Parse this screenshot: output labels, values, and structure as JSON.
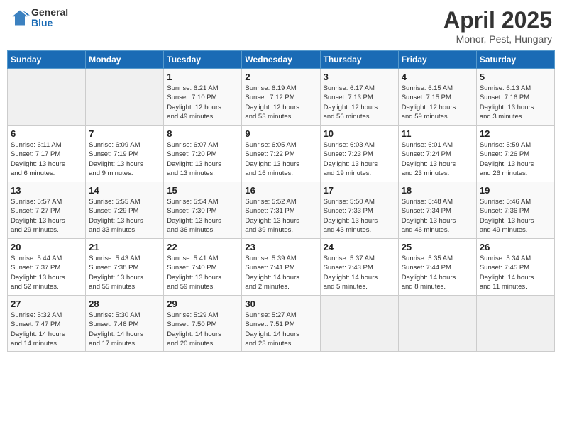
{
  "logo": {
    "general": "General",
    "blue": "Blue"
  },
  "title": "April 2025",
  "subtitle": "Monor, Pest, Hungary",
  "days_of_week": [
    "Sunday",
    "Monday",
    "Tuesday",
    "Wednesday",
    "Thursday",
    "Friday",
    "Saturday"
  ],
  "weeks": [
    [
      {
        "day": "",
        "info": ""
      },
      {
        "day": "",
        "info": ""
      },
      {
        "day": "1",
        "info": "Sunrise: 6:21 AM\nSunset: 7:10 PM\nDaylight: 12 hours\nand 49 minutes."
      },
      {
        "day": "2",
        "info": "Sunrise: 6:19 AM\nSunset: 7:12 PM\nDaylight: 12 hours\nand 53 minutes."
      },
      {
        "day": "3",
        "info": "Sunrise: 6:17 AM\nSunset: 7:13 PM\nDaylight: 12 hours\nand 56 minutes."
      },
      {
        "day": "4",
        "info": "Sunrise: 6:15 AM\nSunset: 7:15 PM\nDaylight: 12 hours\nand 59 minutes."
      },
      {
        "day": "5",
        "info": "Sunrise: 6:13 AM\nSunset: 7:16 PM\nDaylight: 13 hours\nand 3 minutes."
      }
    ],
    [
      {
        "day": "6",
        "info": "Sunrise: 6:11 AM\nSunset: 7:17 PM\nDaylight: 13 hours\nand 6 minutes."
      },
      {
        "day": "7",
        "info": "Sunrise: 6:09 AM\nSunset: 7:19 PM\nDaylight: 13 hours\nand 9 minutes."
      },
      {
        "day": "8",
        "info": "Sunrise: 6:07 AM\nSunset: 7:20 PM\nDaylight: 13 hours\nand 13 minutes."
      },
      {
        "day": "9",
        "info": "Sunrise: 6:05 AM\nSunset: 7:22 PM\nDaylight: 13 hours\nand 16 minutes."
      },
      {
        "day": "10",
        "info": "Sunrise: 6:03 AM\nSunset: 7:23 PM\nDaylight: 13 hours\nand 19 minutes."
      },
      {
        "day": "11",
        "info": "Sunrise: 6:01 AM\nSunset: 7:24 PM\nDaylight: 13 hours\nand 23 minutes."
      },
      {
        "day": "12",
        "info": "Sunrise: 5:59 AM\nSunset: 7:26 PM\nDaylight: 13 hours\nand 26 minutes."
      }
    ],
    [
      {
        "day": "13",
        "info": "Sunrise: 5:57 AM\nSunset: 7:27 PM\nDaylight: 13 hours\nand 29 minutes."
      },
      {
        "day": "14",
        "info": "Sunrise: 5:55 AM\nSunset: 7:29 PM\nDaylight: 13 hours\nand 33 minutes."
      },
      {
        "day": "15",
        "info": "Sunrise: 5:54 AM\nSunset: 7:30 PM\nDaylight: 13 hours\nand 36 minutes."
      },
      {
        "day": "16",
        "info": "Sunrise: 5:52 AM\nSunset: 7:31 PM\nDaylight: 13 hours\nand 39 minutes."
      },
      {
        "day": "17",
        "info": "Sunrise: 5:50 AM\nSunset: 7:33 PM\nDaylight: 13 hours\nand 43 minutes."
      },
      {
        "day": "18",
        "info": "Sunrise: 5:48 AM\nSunset: 7:34 PM\nDaylight: 13 hours\nand 46 minutes."
      },
      {
        "day": "19",
        "info": "Sunrise: 5:46 AM\nSunset: 7:36 PM\nDaylight: 13 hours\nand 49 minutes."
      }
    ],
    [
      {
        "day": "20",
        "info": "Sunrise: 5:44 AM\nSunset: 7:37 PM\nDaylight: 13 hours\nand 52 minutes."
      },
      {
        "day": "21",
        "info": "Sunrise: 5:43 AM\nSunset: 7:38 PM\nDaylight: 13 hours\nand 55 minutes."
      },
      {
        "day": "22",
        "info": "Sunrise: 5:41 AM\nSunset: 7:40 PM\nDaylight: 13 hours\nand 59 minutes."
      },
      {
        "day": "23",
        "info": "Sunrise: 5:39 AM\nSunset: 7:41 PM\nDaylight: 14 hours\nand 2 minutes."
      },
      {
        "day": "24",
        "info": "Sunrise: 5:37 AM\nSunset: 7:43 PM\nDaylight: 14 hours\nand 5 minutes."
      },
      {
        "day": "25",
        "info": "Sunrise: 5:35 AM\nSunset: 7:44 PM\nDaylight: 14 hours\nand 8 minutes."
      },
      {
        "day": "26",
        "info": "Sunrise: 5:34 AM\nSunset: 7:45 PM\nDaylight: 14 hours\nand 11 minutes."
      }
    ],
    [
      {
        "day": "27",
        "info": "Sunrise: 5:32 AM\nSunset: 7:47 PM\nDaylight: 14 hours\nand 14 minutes."
      },
      {
        "day": "28",
        "info": "Sunrise: 5:30 AM\nSunset: 7:48 PM\nDaylight: 14 hours\nand 17 minutes."
      },
      {
        "day": "29",
        "info": "Sunrise: 5:29 AM\nSunset: 7:50 PM\nDaylight: 14 hours\nand 20 minutes."
      },
      {
        "day": "30",
        "info": "Sunrise: 5:27 AM\nSunset: 7:51 PM\nDaylight: 14 hours\nand 23 minutes."
      },
      {
        "day": "",
        "info": ""
      },
      {
        "day": "",
        "info": ""
      },
      {
        "day": "",
        "info": ""
      }
    ]
  ]
}
